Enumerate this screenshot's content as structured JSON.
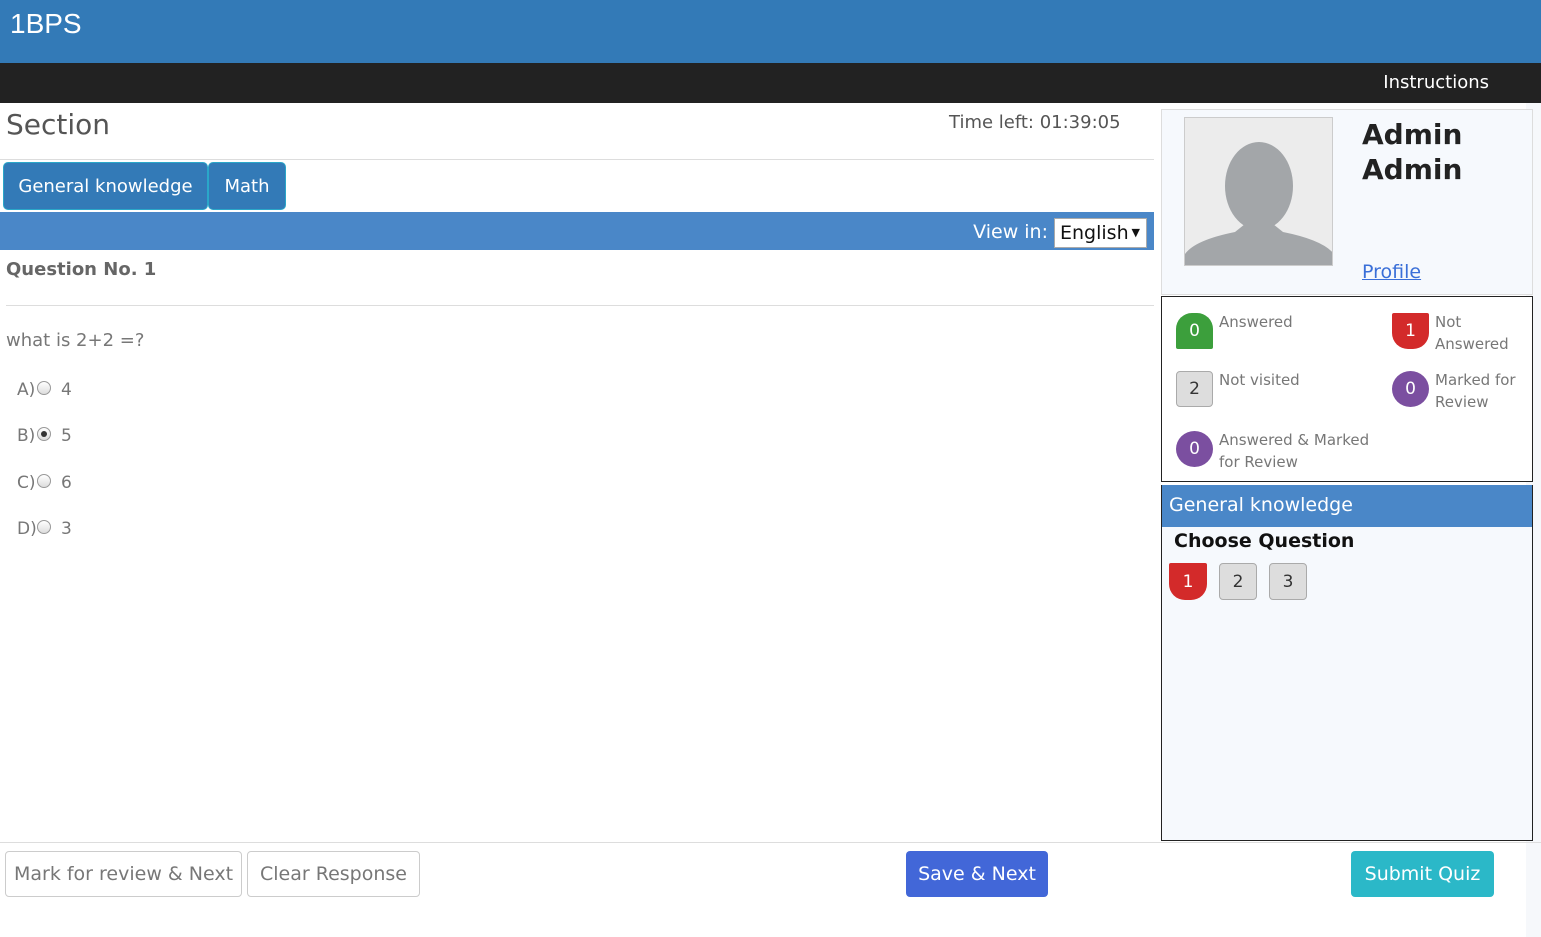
{
  "brand": "1BPS",
  "nav": {
    "instructions": "Instructions"
  },
  "section": {
    "title": "Section",
    "time_left": "Time left: 01:39:05"
  },
  "tabs": [
    {
      "label": "General knowledge"
    },
    {
      "label": "Math"
    }
  ],
  "view_in": {
    "label": "View in:",
    "selected": "English"
  },
  "question": {
    "number": "Question No. 1",
    "text": "what is 2+2 =?",
    "options": [
      {
        "letter": "A)",
        "text": "4",
        "checked": false
      },
      {
        "letter": "B)",
        "text": "5",
        "checked": true
      },
      {
        "letter": "C)",
        "text": "6",
        "checked": false
      },
      {
        "letter": "D)",
        "text": "3",
        "checked": false
      }
    ]
  },
  "buttons": {
    "mark_review": "Mark for review & Next",
    "clear": "Clear Response",
    "save_next": "Save & Next",
    "submit": "Submit Quiz"
  },
  "user": {
    "first": "Admin",
    "last": "Admin",
    "profile_link": "Profile"
  },
  "legend": {
    "answered": {
      "count": "0",
      "label": "Answered"
    },
    "not_answered": {
      "count": "1",
      "label_1": "Not",
      "label_2": "Answered"
    },
    "not_visited": {
      "count": "2",
      "label": "Not visited"
    },
    "marked": {
      "count": "0",
      "label_1": "Marked for",
      "label_2": "Review"
    },
    "answered_marked": {
      "count": "0",
      "label_1": "Answered & Marked",
      "label_2": "for Review"
    }
  },
  "question_panel": {
    "section_name": "General knowledge",
    "choose_label": "Choose Question",
    "questions": [
      "1",
      "2",
      "3"
    ]
  },
  "colors": {
    "primary": "#337ab7",
    "answered": "#3c9f3c",
    "not_answered": "#d32a2a",
    "marked": "#7b4fa0",
    "save": "#4267d8",
    "submit": "#2bb8c8"
  }
}
